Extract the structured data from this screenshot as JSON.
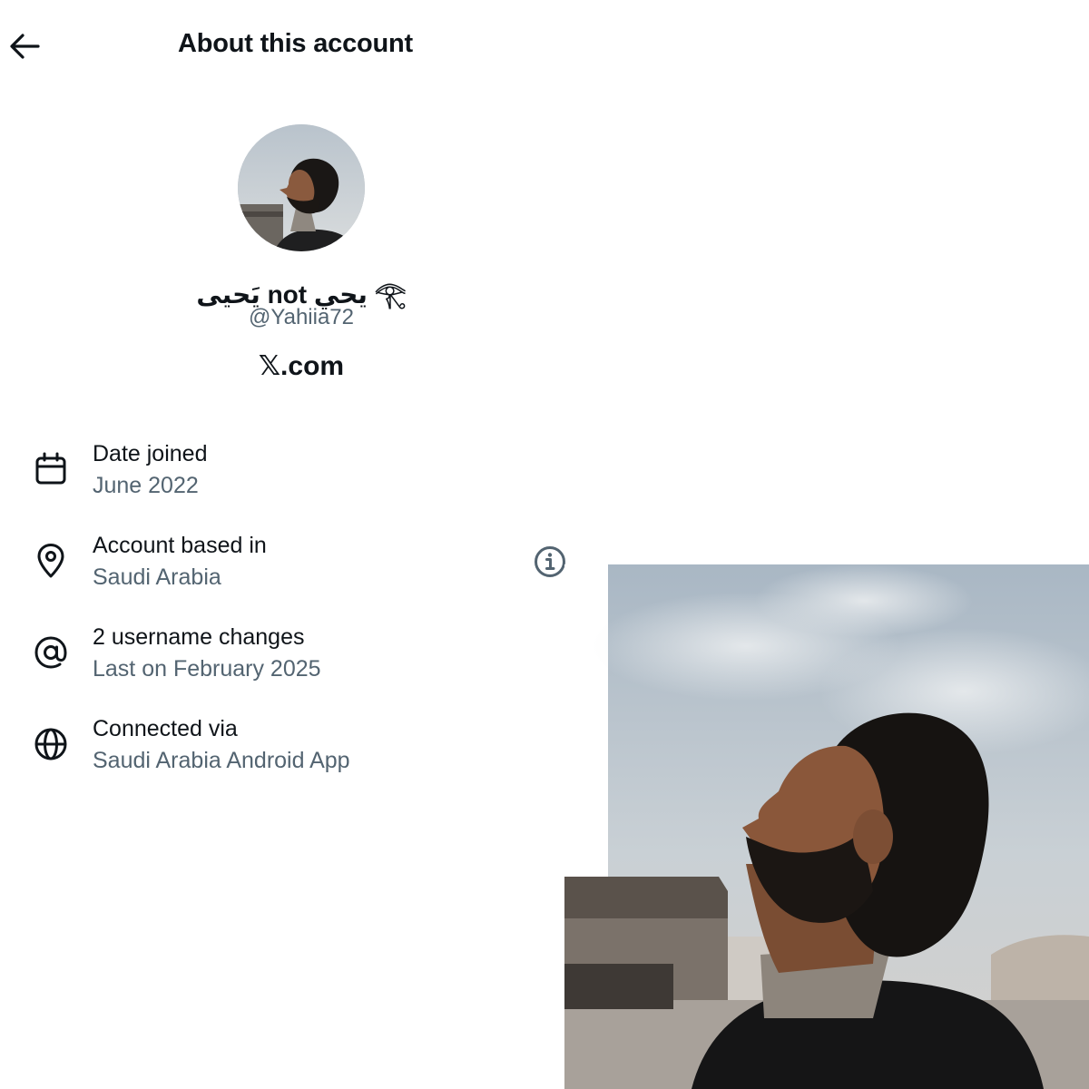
{
  "header": {
    "title": "About this account",
    "back_icon": "arrow-left-icon"
  },
  "profile": {
    "display_name": "يَحيى not يحي 𓂀",
    "handle": "@Yahiia72",
    "source_label": "𝕏.com"
  },
  "details": [
    {
      "icon": "calendar-icon",
      "label": "Date joined",
      "value": "June 2022"
    },
    {
      "icon": "location-pin-icon",
      "label": "Account based in",
      "value": "Saudi Arabia",
      "info_icon": "info-icon"
    },
    {
      "icon": "at-sign-icon",
      "label": "2 username changes",
      "value": "Last on February 2025"
    },
    {
      "icon": "globe-icon",
      "label": "Connected via",
      "value": "Saudi Arabia Android App"
    }
  ],
  "colors": {
    "primary_text": "#0f1419",
    "secondary_text": "#536471",
    "background": "#ffffff"
  }
}
